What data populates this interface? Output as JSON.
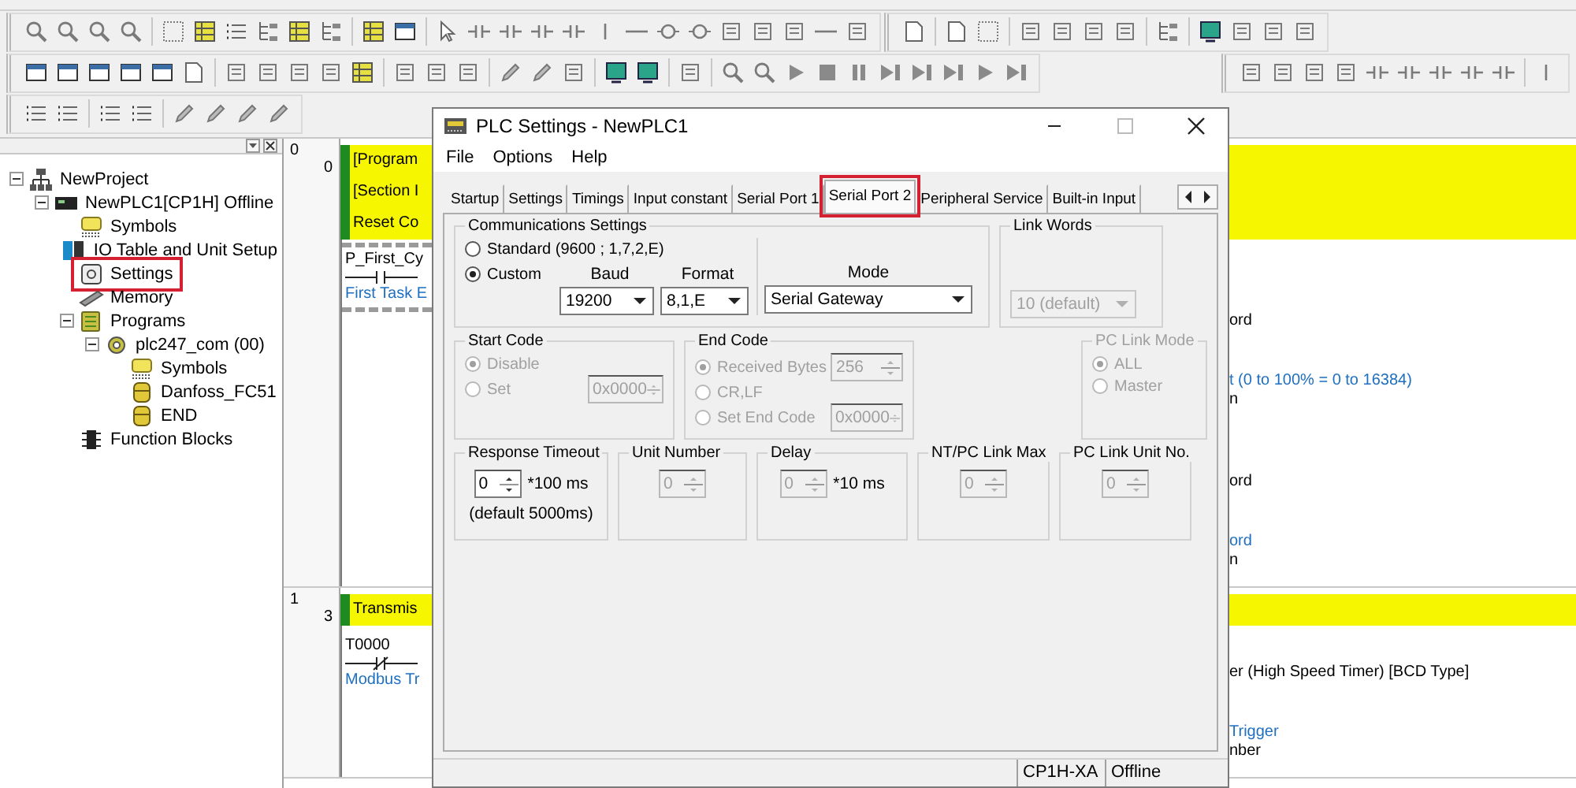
{
  "tree": [
    {
      "label": "NewProject",
      "kind": "project",
      "selected": false,
      "highlighted": false,
      "expanded": true,
      "children": [
        {
          "label": "NewPLC1[CP1H] Offline",
          "kind": "plc",
          "selected": false,
          "highlighted": false,
          "expanded": true,
          "children": [
            {
              "label": "Symbols",
              "kind": "symbols",
              "selected": false,
              "highlighted": false
            },
            {
              "label": "IO Table and Unit Setup",
              "kind": "io",
              "selected": false,
              "highlighted": false
            },
            {
              "label": "Settings",
              "kind": "settings",
              "selected": false,
              "highlighted": true
            },
            {
              "label": "Memory",
              "kind": "memory",
              "selected": false,
              "highlighted": false
            },
            {
              "label": "Programs",
              "kind": "programs",
              "selected": false,
              "highlighted": false,
              "expanded": true,
              "children": [
                {
                  "label": "plc247_com (00)",
                  "kind": "program",
                  "selected": false,
                  "highlighted": false,
                  "expanded": true,
                  "children": [
                    {
                      "label": "Symbols",
                      "kind": "symbols",
                      "selected": false,
                      "highlighted": false
                    },
                    {
                      "label": "Danfoss_FC51",
                      "kind": "section",
                      "selected": false,
                      "highlighted": false
                    },
                    {
                      "label": "END",
                      "kind": "section",
                      "selected": false,
                      "highlighted": false
                    }
                  ]
                }
              ]
            },
            {
              "label": "Function Blocks",
              "kind": "fb",
              "selected": false,
              "highlighted": false
            }
          ]
        }
      ]
    }
  ],
  "rungs": [
    {
      "number": "0",
      "step": "0",
      "header": [
        "[Program",
        "[Section I",
        "Reset Co"
      ],
      "contact": {
        "kind": "no",
        "name": "P_First_Cy",
        "comment": "First Task E",
        "hatched": true
      },
      "instructions": [
        {
          "operands": [
            [
              {
                "text": "ord",
                "kind": "name"
              }
            ],
            [
              {
                "text": "t (0 to 100% = 0 to 16384)",
                "kind": "comment"
              },
              {
                "text": "n",
                "kind": "name"
              }
            ]
          ]
        },
        {
          "operands": [
            [
              {
                "text": "ord",
                "kind": "name"
              }
            ],
            [
              {
                "text": "ord",
                "kind": "comment"
              },
              {
                "text": "n",
                "kind": "name"
              }
            ]
          ]
        }
      ]
    },
    {
      "number": "1",
      "step": "3",
      "header": [
        "Transmis"
      ],
      "contact": {
        "kind": "nc",
        "name": "T0000",
        "comment": "Modbus Tr",
        "hatched": false
      },
      "instructions": [
        {
          "operands": [
            [
              {
                "text": "er (High Speed Timer) [BCD Type]",
                "kind": "name"
              }
            ],
            [
              {
                "text": "Trigger",
                "kind": "comment"
              },
              {
                "text": "nber",
                "kind": "name"
              }
            ]
          ]
        }
      ]
    }
  ],
  "dialog": {
    "title": "PLC Settings - NewPLC1",
    "menu": [
      "File",
      "Options",
      "Help"
    ],
    "tabs": [
      {
        "label": "Startup",
        "selected": false,
        "highlighted": false
      },
      {
        "label": "Settings",
        "selected": false,
        "highlighted": false
      },
      {
        "label": "Timings",
        "selected": false,
        "highlighted": false
      },
      {
        "label": "Input constant",
        "selected": false,
        "highlighted": false
      },
      {
        "label": "Serial Port 1",
        "selected": false,
        "highlighted": false
      },
      {
        "label": "Serial Port 2",
        "selected": true,
        "highlighted": true
      },
      {
        "label": "Peripheral Service",
        "selected": false,
        "highlighted": false
      },
      {
        "label": "Built-in Input",
        "selected": false,
        "highlighted": false
      }
    ],
    "communications": {
      "title": "Communications Settings",
      "options": [
        {
          "label": "Standard (9600 ; 1,7,2,E)",
          "selected": false
        },
        {
          "label": "Custom",
          "selected": true
        }
      ],
      "baud": {
        "label": "Baud",
        "value": "19200"
      },
      "format": {
        "label": "Format",
        "value": "8,1,E"
      },
      "mode": {
        "label": "Mode",
        "value": "Serial Gateway"
      }
    },
    "link_words": {
      "title": "Link Words",
      "value": "10 (default)",
      "disabled": true
    },
    "start_code": {
      "title": "Start Code",
      "disabled": true,
      "options": [
        {
          "label": "Disable",
          "selected": true
        },
        {
          "label": "Set",
          "selected": false,
          "value": "0x0000"
        }
      ]
    },
    "end_code": {
      "title": "End Code",
      "disabled": true,
      "options": [
        {
          "label": "Received Bytes",
          "selected": true,
          "value": "256"
        },
        {
          "label": "CR,LF",
          "selected": false
        },
        {
          "label": "Set End Code",
          "selected": false,
          "value": "0x0000"
        }
      ]
    },
    "pc_link_mode": {
      "title": "PC Link Mode",
      "disabled": true,
      "options": [
        {
          "label": "ALL",
          "selected": true
        },
        {
          "label": "Master",
          "selected": false
        }
      ]
    },
    "spinners": [
      {
        "title": "Response Timeout",
        "value": "0",
        "unit": "*100 ms",
        "note": "(default 5000ms)",
        "disabled": false
      },
      {
        "title": "Unit Number",
        "value": "0",
        "disabled": true
      },
      {
        "title": "Delay",
        "value": "0",
        "unit": "*10 ms",
        "disabled": true
      },
      {
        "title": "NT/PC Link Max",
        "value": "0",
        "disabled": true
      },
      {
        "title": "PC Link Unit No.",
        "value": "0",
        "disabled": true
      }
    ],
    "status": [
      "CP1H-XA",
      "Offline"
    ]
  }
}
